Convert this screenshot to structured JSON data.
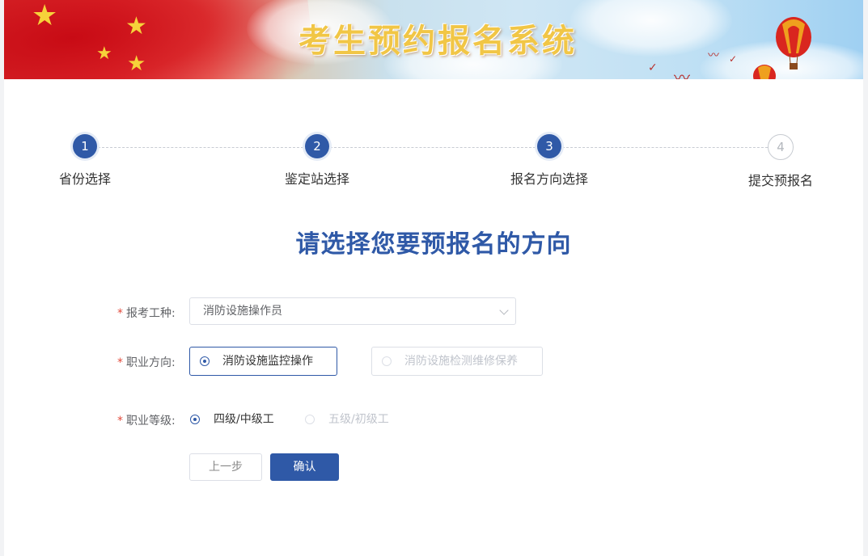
{
  "banner": {
    "title": "考生预约报名系统"
  },
  "steps": [
    {
      "number": "1",
      "label": "省份选择",
      "state": "done"
    },
    {
      "number": "2",
      "label": "鉴定站选择",
      "state": "done"
    },
    {
      "number": "3",
      "label": "报名方向选择",
      "state": "active"
    },
    {
      "number": "4",
      "label": "提交预报名",
      "state": "pending"
    }
  ],
  "heading": "请选择您要预报名的方向",
  "form": {
    "required_mark": "*",
    "job_type": {
      "label": "报考工种:",
      "value": "消防设施操作员"
    },
    "direction": {
      "label": "职业方向:",
      "options": [
        {
          "label": "消防设施监控操作",
          "checked": true
        },
        {
          "label": "消防设施检测维修保养",
          "checked": false
        }
      ]
    },
    "level": {
      "label": "职业等级:",
      "options": [
        {
          "label": "四级/中级工",
          "checked": true
        },
        {
          "label": "五级/初级工",
          "checked": false
        }
      ]
    },
    "prev_button": "上一步",
    "confirm_button": "确认"
  },
  "colors": {
    "primary": "#2f59a7",
    "required": "#e24a3b",
    "banner_title": "#f1c646"
  }
}
